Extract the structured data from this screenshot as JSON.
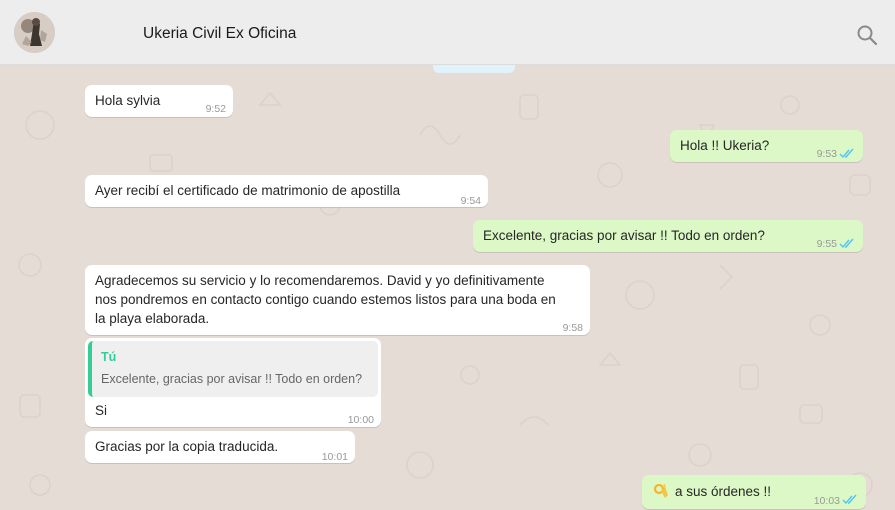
{
  "header": {
    "contact_name": "Ukeria Civil Ex Oficina"
  },
  "colors": {
    "header_bg": "#ededed",
    "chat_bg": "#e5ddd5",
    "incoming_bubble": "#ffffff",
    "outgoing_bubble": "#dcf8c6",
    "read_ticks": "#4fc3f7",
    "quote_accent": "#35cd96"
  },
  "messages": [
    {
      "direction": "in",
      "text": "Hola sylvia",
      "time": "9:52"
    },
    {
      "direction": "out",
      "text": "Hola !! Ukeria?",
      "time": "9:53",
      "status": "read"
    },
    {
      "direction": "in",
      "text": "Ayer recibí el certificado de matrimonio de apostilla",
      "time": "9:54"
    },
    {
      "direction": "out",
      "text": "Excelente, gracias por avisar !! Todo en orden?",
      "time": "9:55",
      "status": "read"
    },
    {
      "direction": "in",
      "lines": [
        "Agradecemos su servicio y lo recomendaremos. David y yo definitivamente",
        "nos pondremos en contacto contigo cuando estemos listos para una boda en",
        "la playa elaborada."
      ],
      "time": "9:58"
    },
    {
      "direction": "in",
      "quote": {
        "author": "Tú",
        "text": "Excelente, gracias por avisar !! Todo en orden?"
      },
      "text": "Si",
      "time": "10:00"
    },
    {
      "direction": "in",
      "text": "Gracias por la copia traducida.",
      "time": "10:01"
    },
    {
      "direction": "out",
      "emoji": "ok-hand-emoji",
      "text": "a sus órdenes !!",
      "time": "10:03",
      "status": "read"
    }
  ]
}
